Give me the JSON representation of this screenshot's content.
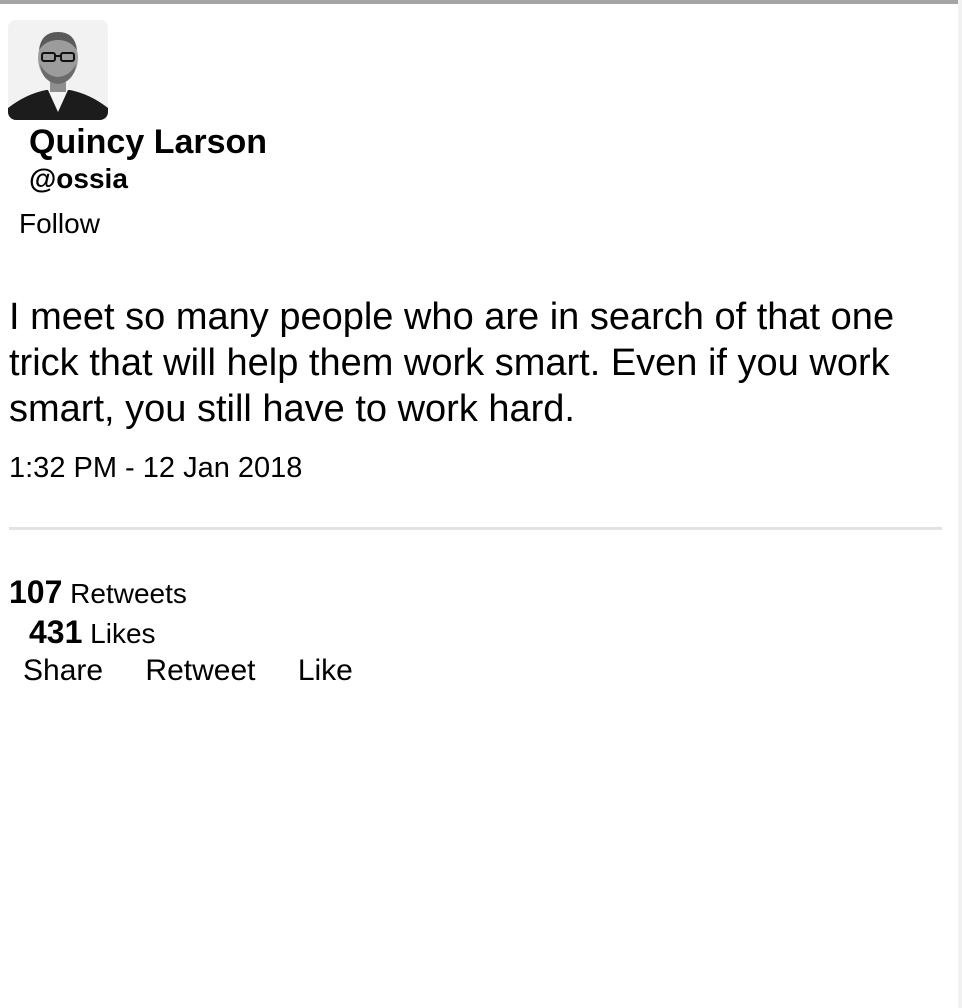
{
  "user": {
    "name": "Quincy Larson",
    "handle": "@ossia",
    "follow_label": "Follow"
  },
  "tweet": {
    "text": "I meet so many people who are in search of that one trick that will help them work smart. Even if you work smart, you still have to work hard.",
    "timestamp": "1:32 PM - 12 Jan 2018"
  },
  "stats": {
    "retweets_count": "107",
    "retweets_label": "Retweets",
    "likes_count": "431",
    "likes_label": "Likes"
  },
  "actions": {
    "share": "Share",
    "retweet": "Retweet",
    "like": "Like"
  },
  "colors": {
    "top_border": "#a4a4a4",
    "divider": "#e3e3e3"
  }
}
